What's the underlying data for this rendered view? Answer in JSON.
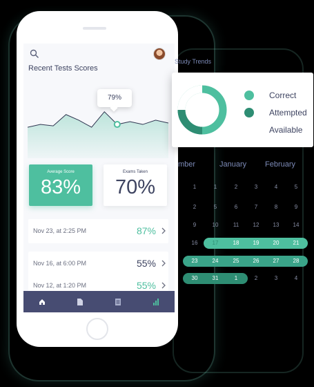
{
  "colors": {
    "accent": "#4ebf9f",
    "accent_dark": "#2e8d73",
    "navy": "#474c72",
    "text": "#3d4360"
  },
  "header": {
    "title": "Recent Tests Scores",
    "search_icon": "search-icon",
    "avatar_icon": "avatar"
  },
  "chart_data": {
    "type": "area",
    "x": [
      1,
      2,
      3,
      4,
      5,
      6,
      7,
      8,
      9,
      10,
      11,
      12
    ],
    "series": [
      {
        "values": [
          44,
          48,
          46,
          62,
          54,
          44,
          66,
          48,
          52,
          48,
          54,
          50
        ]
      }
    ],
    "tooltip_label": "79%",
    "highlight_index": 7
  },
  "stats": {
    "average_label": "Average Score",
    "average_value": "83%",
    "exams_label": "Exams Taken",
    "exams_value": "70%"
  },
  "recent": [
    {
      "date": "Nov 23, at 2:25 PM",
      "score": "87%",
      "color": "#4ebf9f"
    },
    {
      "date": "Nov 16, at 6:00 PM",
      "score": "55%",
      "color": "#3d4360"
    },
    {
      "date": "Nov 12, at 1:20 PM",
      "score": "55%",
      "color": "#4ebf9f"
    }
  ],
  "tabs": [
    "home-icon",
    "document-icon",
    "list-icon",
    "chart-icon"
  ],
  "legend": {
    "heading": "Study Trends",
    "correct": "Correct",
    "attempted": "Attempted",
    "available": "Available"
  },
  "calendar": {
    "months": [
      "mber",
      "January",
      "February"
    ],
    "row1": [
      "1",
      "1",
      "2",
      "3",
      "4",
      "5"
    ],
    "row2": [
      "2",
      "5",
      "6",
      "7",
      "8",
      "9"
    ],
    "row3": [
      "9",
      "10",
      "11",
      "12",
      "13",
      "14"
    ],
    "row4": [
      "16",
      "17",
      "18",
      "19",
      "20",
      "21"
    ],
    "row5": [
      "23",
      "24",
      "25",
      "26",
      "27",
      "28"
    ],
    "row6": [
      "30",
      "31",
      "1",
      "2",
      "3",
      "4"
    ]
  }
}
